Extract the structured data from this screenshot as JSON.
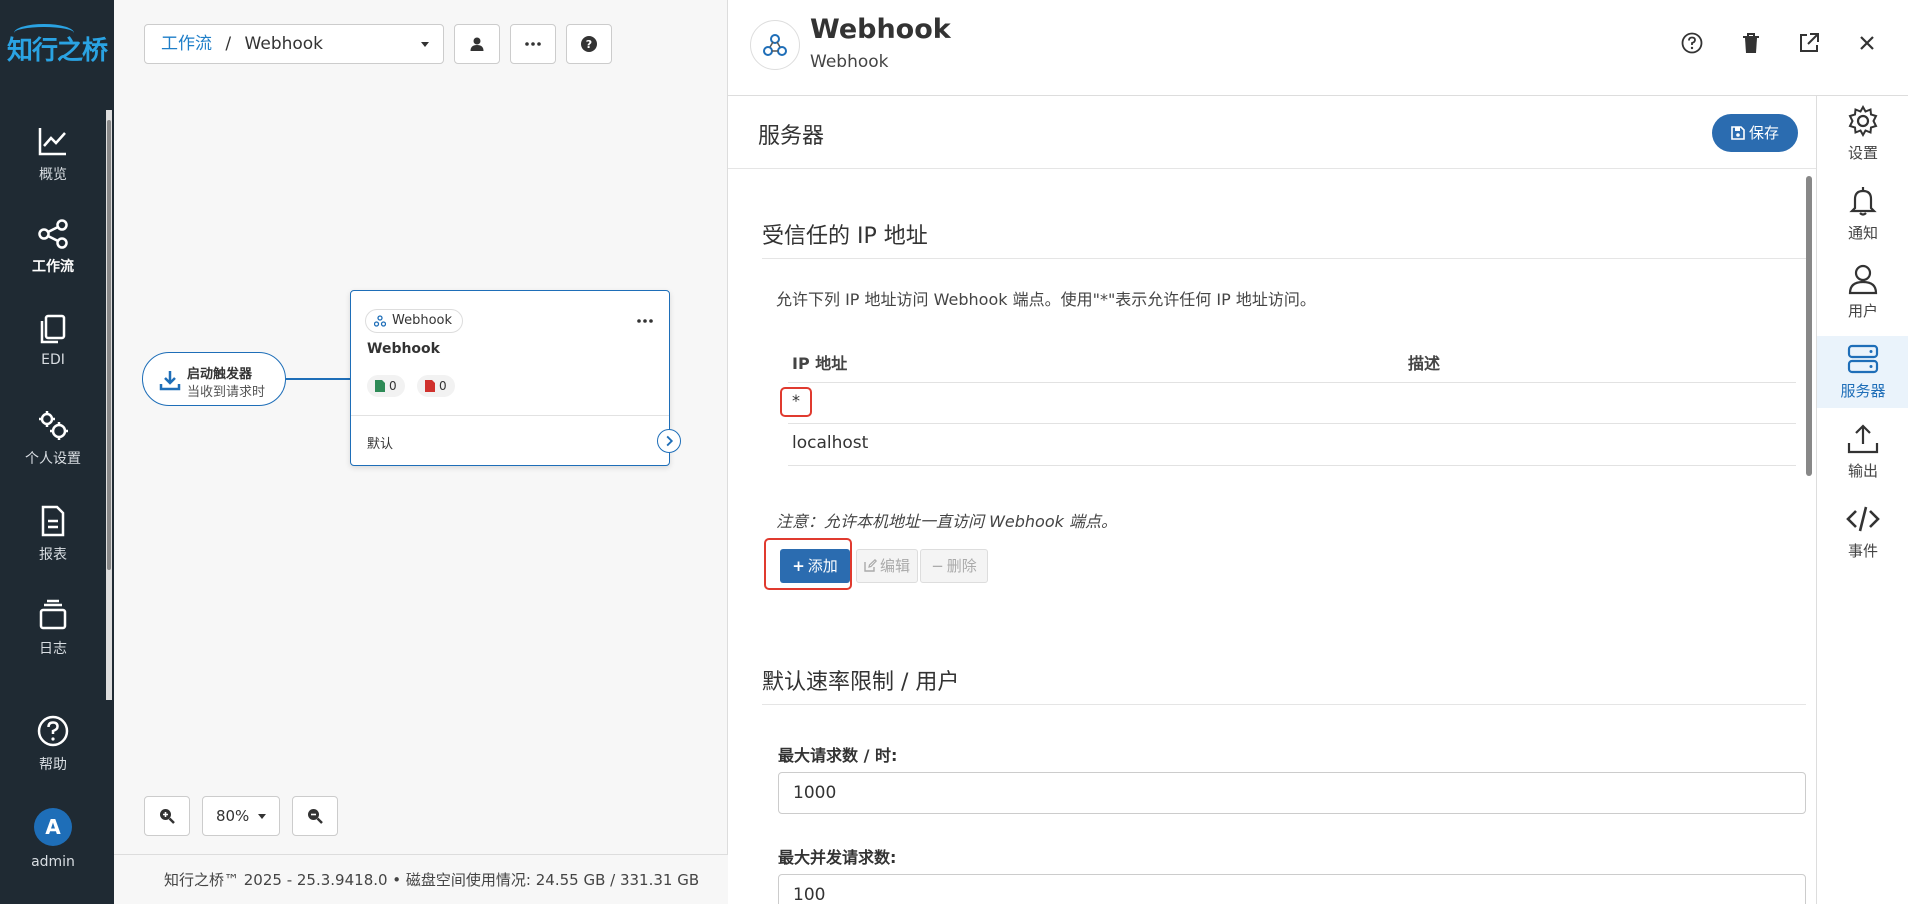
{
  "brand": {
    "name": "知行之桥"
  },
  "leftnav": {
    "items": [
      {
        "label": "概览"
      },
      {
        "label": "工作流"
      },
      {
        "label": "EDI"
      },
      {
        "label": "个人设置"
      },
      {
        "label": "报表"
      },
      {
        "label": "日志"
      },
      {
        "label": "帮助"
      }
    ],
    "user": {
      "initial": "A",
      "name": "admin"
    }
  },
  "canvas": {
    "breadcrumb": {
      "root": "工作流",
      "separator": "/",
      "current": "Webhook"
    },
    "trigger": {
      "title": "启动触发器",
      "subtitle": "当收到请求时"
    },
    "node": {
      "tag": "Webhook",
      "title": "Webhook",
      "success_count": "0",
      "error_count": "0",
      "route": "默认"
    },
    "zoom": {
      "level": "80%"
    },
    "footer": {
      "text": "知行之桥™ 2025 - 25.3.9418.0  •  磁盘空间使用情况:   24.55 GB / 331.31 GB"
    }
  },
  "panel": {
    "title": "Webhook",
    "subtitle": "Webhook",
    "section": "服务器",
    "save_label": "保存",
    "trusted_ip": {
      "heading": "受信任的 IP 地址",
      "description": "允许下列 IP 地址访问 Webhook 端点。使用\"*\"表示允许任何 IP 地址访问。",
      "columns": [
        "IP 地址",
        "描述"
      ],
      "rows": [
        {
          "ip": "*",
          "description": ""
        },
        {
          "ip": "localhost",
          "description": ""
        }
      ],
      "note": "注意：允许本机地址一直访问 Webhook 端点。",
      "add_label": "添加",
      "edit_label": "编辑",
      "delete_label": "删除"
    },
    "rate_limit": {
      "heading": "默认速率限制 / 用户",
      "max_requests_label": "最大请求数 / 时:",
      "max_requests_value": "1000",
      "max_concurrent_label": "最大并发请求数:",
      "max_concurrent_value": "100"
    },
    "rightnav": [
      {
        "label": "设置"
      },
      {
        "label": "通知"
      },
      {
        "label": "用户"
      },
      {
        "label": "服务器"
      },
      {
        "label": "输出"
      },
      {
        "label": "事件"
      }
    ]
  }
}
